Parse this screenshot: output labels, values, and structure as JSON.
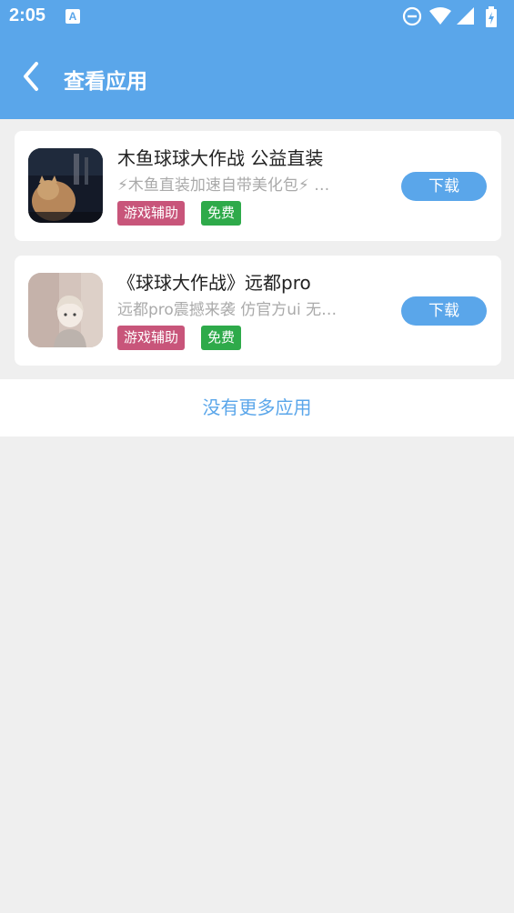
{
  "status": {
    "time": "2:05",
    "notification_icon": "a-notification-icon",
    "icons": [
      "dnd-icon",
      "wifi-icon",
      "signal-icon",
      "battery-icon"
    ]
  },
  "header": {
    "back_icon": "chevron-left-icon",
    "title": "查看应用"
  },
  "apps": [
    {
      "title": "木鱼球球大作战 公益直装",
      "description": "⚡木鱼直装加速自带美化包⚡ …",
      "tag_type": "游戏辅助",
      "tag_price": "免费",
      "download_label": "下载"
    },
    {
      "title": "《球球大作战》远都pro",
      "description": "远都pro震撼来袭 仿官方ui 无…",
      "tag_type": "游戏辅助",
      "tag_price": "免费",
      "download_label": "下载"
    }
  ],
  "footer": {
    "no_more": "没有更多应用"
  },
  "colors": {
    "primary": "#5aa6ea",
    "tag_type": "#c8557a",
    "tag_free": "#2eaa4a",
    "background": "#efefef"
  }
}
